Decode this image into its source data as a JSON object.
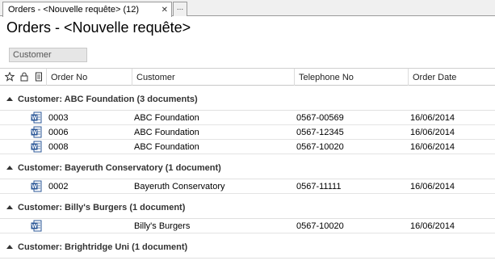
{
  "tabs": [
    {
      "label": "Orders - <Nouvelle requête> (12)",
      "active": true
    },
    {
      "label": "..."
    }
  ],
  "page_title": "Orders - <Nouvelle requête>",
  "group_by_chip": "Customer",
  "columns": {
    "order_no": "Order No",
    "customer": "Customer",
    "telephone": "Telephone No",
    "order_date": "Order Date"
  },
  "groups": [
    {
      "label": "Customer: ABC Foundation (3 documents)",
      "rows": [
        {
          "order_no": "0003",
          "customer": "ABC Foundation",
          "telephone": "0567-00569",
          "order_date": "16/06/2014"
        },
        {
          "order_no": "0006",
          "customer": "ABC Foundation",
          "telephone": "0567-12345",
          "order_date": "16/06/2014"
        },
        {
          "order_no": "0008",
          "customer": "ABC Foundation",
          "telephone": "0567-10020",
          "order_date": "16/06/2014"
        }
      ]
    },
    {
      "label": "Customer: Bayeruth Conservatory (1 document)",
      "rows": [
        {
          "order_no": "0002",
          "customer": "Bayeruth Conservatory",
          "telephone": "0567-11111",
          "order_date": "16/06/2014"
        }
      ]
    },
    {
      "label": "Customer: Billy's Burgers (1 document)",
      "rows": [
        {
          "order_no": "",
          "customer": "Billy's Burgers",
          "telephone": "0567-10020",
          "order_date": "16/06/2014"
        }
      ]
    },
    {
      "label": "Customer: Brightridge Uni (1 document)",
      "rows": []
    }
  ]
}
